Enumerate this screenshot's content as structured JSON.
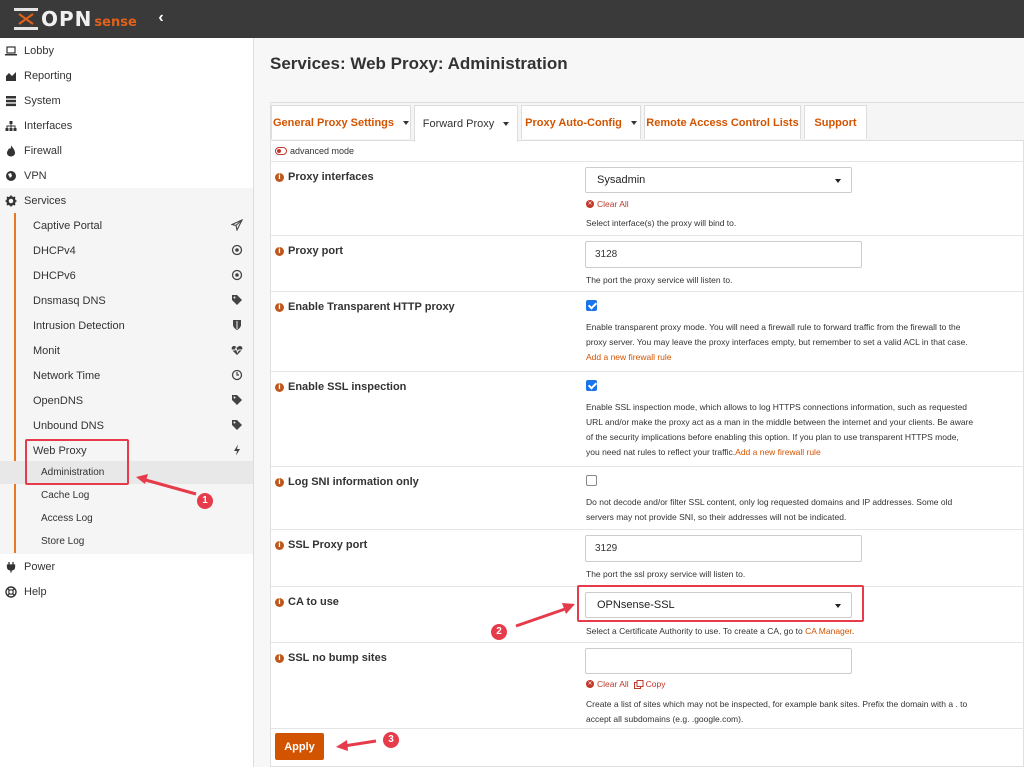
{
  "brand": {
    "name": "OPN",
    "suffix": "sense"
  },
  "sidebar": {
    "items": [
      {
        "label": "Lobby",
        "icon": "laptop-icon"
      },
      {
        "label": "Reporting",
        "icon": "area-chart-icon"
      },
      {
        "label": "System",
        "icon": "server-icon"
      },
      {
        "label": "Interfaces",
        "icon": "sitemap-icon"
      },
      {
        "label": "Firewall",
        "icon": "fire-icon"
      },
      {
        "label": "VPN",
        "icon": "globe-icon"
      },
      {
        "label": "Services",
        "icon": "cog-icon"
      }
    ],
    "services_sub": [
      {
        "label": "Captive Portal",
        "icon": "paper-plane-icon"
      },
      {
        "label": "DHCPv4",
        "icon": "bullseye-icon"
      },
      {
        "label": "DHCPv6",
        "icon": "bullseye-icon"
      },
      {
        "label": "Dnsmasq DNS",
        "icon": "tags-icon"
      },
      {
        "label": "Intrusion Detection",
        "icon": "shield-icon"
      },
      {
        "label": "Monit",
        "icon": "heartbeat-icon"
      },
      {
        "label": "Network Time",
        "icon": "clock-icon"
      },
      {
        "label": "OpenDNS",
        "icon": "tags-icon"
      },
      {
        "label": "Unbound DNS",
        "icon": "tags-icon"
      },
      {
        "label": "Web Proxy",
        "icon": "bolt-icon"
      }
    ],
    "web_proxy_sub": [
      "Administration",
      "Cache Log",
      "Access Log",
      "Store Log"
    ],
    "bottom": [
      {
        "label": "Power",
        "icon": "plug-icon"
      },
      {
        "label": "Help",
        "icon": "life-ring-icon"
      }
    ]
  },
  "page": {
    "title": "Services: Web Proxy: Administration"
  },
  "tabs": [
    {
      "label": "General Proxy Settings"
    },
    {
      "label": "Forward Proxy"
    },
    {
      "label": "Proxy Auto-Config"
    },
    {
      "label": "Remote Access Control Lists"
    },
    {
      "label": "Support"
    }
  ],
  "advanced_mode": "advanced mode",
  "form": {
    "proxy_interfaces": {
      "label": "Proxy interfaces",
      "value": "Sysadmin",
      "clear": "Clear All",
      "help": "Select interface(s) the proxy will bind to."
    },
    "proxy_port": {
      "label": "Proxy port",
      "value": "3128",
      "help": "The port the proxy service will listen to."
    },
    "transparent": {
      "label": "Enable Transparent HTTP proxy",
      "checked": true,
      "help1": "Enable transparent proxy mode. You will need a firewall rule to forward traffic from the firewall to the",
      "help2": "proxy server. You may leave the proxy interfaces empty, but remember to set a valid ACL in that case.",
      "link": "Add a new firewall rule"
    },
    "ssl_inspection": {
      "label": "Enable SSL inspection",
      "checked": true,
      "help1": "Enable SSL inspection mode, which allows to log HTTPS connections information, such as requested",
      "help2": "URL and/or make the proxy act as a man in the middle between the internet and your clients. Be aware",
      "help3": "of the security implications before enabling this option. If you plan to use transparent HTTPS mode,",
      "help4": "you need nat rules to reflect your traffic.",
      "link": "Add a new firewall rule"
    },
    "sni_only": {
      "label": "Log SNI information only",
      "checked": false,
      "help1": "Do not decode and/or filter SSL content, only log requested domains and IP addresses. Some old",
      "help2": "servers may not provide SNI, so their addresses will not be indicated."
    },
    "ssl_port": {
      "label": "SSL Proxy port",
      "value": "3129",
      "help": "The port the ssl proxy service will listen to."
    },
    "ca": {
      "label": "CA to use",
      "value": "OPNsense-SSL",
      "help": "Select a Certificate Authority to use. To create a CA, go to ",
      "link": "CA Manager",
      "help_end": "."
    },
    "no_bump": {
      "label": "SSL no bump sites",
      "value": "",
      "clear": "Clear All",
      "copy": "Copy",
      "help1": "Create a list of sites which may not be inspected, for example bank sites. Prefix the domain with a . to",
      "help2": "accept all subdomains (e.g. .google.com)."
    }
  },
  "apply_label": "Apply",
  "annotations": [
    "1",
    "2",
    "3"
  ],
  "colors": {
    "accent": "#d35400",
    "annotation": "#e53b4a",
    "topbar": "#3a3a3a"
  }
}
